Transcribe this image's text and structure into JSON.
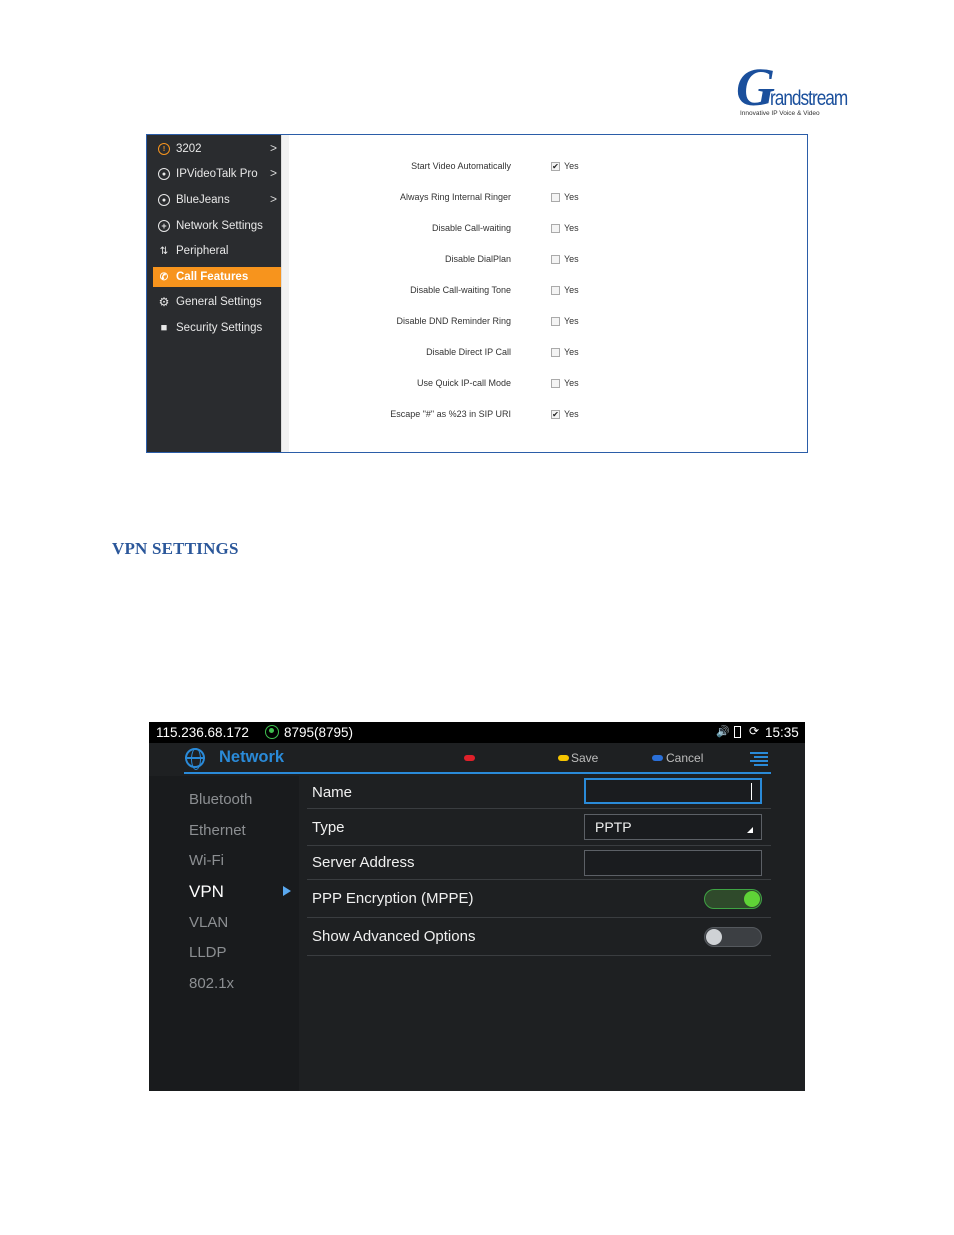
{
  "logo": {
    "brand": "Grandstream",
    "initial": "G",
    "word": "randstream",
    "tagline": "Innovative IP Voice & Video"
  },
  "call_features_screenshot": {
    "sidebar": [
      {
        "label": "3202",
        "icon": "account-icon",
        "active": false,
        "chevron": true
      },
      {
        "label": "IPVideoTalk Pro",
        "icon": "account-icon",
        "active": false,
        "chevron": true
      },
      {
        "label": "BlueJeans",
        "icon": "account-icon",
        "active": false,
        "chevron": true
      },
      {
        "label": "Network Settings",
        "icon": "globe-icon",
        "active": false,
        "chevron": false
      },
      {
        "label": "Peripheral",
        "icon": "peripheral-icon",
        "active": false,
        "chevron": false
      },
      {
        "label": "Call Features",
        "icon": "phone-icon",
        "active": true,
        "chevron": false
      },
      {
        "label": "General Settings",
        "icon": "gear-icon",
        "active": false,
        "chevron": false
      },
      {
        "label": "Security Settings",
        "icon": "lock-icon",
        "active": false,
        "chevron": false
      }
    ],
    "chevron_glyph": ">",
    "option_value_label": "Yes",
    "options": [
      {
        "label": "Start Video Automatically",
        "checked": true
      },
      {
        "label": "Always Ring Internal Ringer",
        "checked": false
      },
      {
        "label": "Disable Call-waiting",
        "checked": false
      },
      {
        "label": "Disable DialPlan",
        "checked": false
      },
      {
        "label": "Disable Call-waiting Tone",
        "checked": false
      },
      {
        "label": "Disable DND Reminder Ring",
        "checked": false
      },
      {
        "label": "Disable Direct IP Call",
        "checked": false
      },
      {
        "label": "Use Quick IP-call Mode",
        "checked": false
      },
      {
        "label": "Escape \"#\" as %23 in SIP URI",
        "checked": true
      }
    ]
  },
  "section_heading": "VPN SETTINGS",
  "vpn_screenshot": {
    "status_bar": {
      "ip": "115.236.68.172",
      "account": "8795(8795)",
      "time": "15:35"
    },
    "header": {
      "title": "Network",
      "save": "Save",
      "cancel": "Cancel"
    },
    "nav": [
      {
        "label": "Bluetooth",
        "active": false
      },
      {
        "label": "Ethernet",
        "active": false
      },
      {
        "label": "Wi-Fi",
        "active": false
      },
      {
        "label": "VPN",
        "active": true
      },
      {
        "label": "VLAN",
        "active": false
      },
      {
        "label": "LLDP",
        "active": false
      },
      {
        "label": "802.1x",
        "active": false
      }
    ],
    "fields": {
      "name_label": "Name",
      "name_value": "",
      "type_label": "Type",
      "type_value": "PPTP",
      "server_label": "Server Address",
      "server_value": "",
      "mppe_label": "PPP Encryption (MPPE)",
      "mppe_on": true,
      "advanced_label": "Show Advanced Options",
      "advanced_on": false
    },
    "colors": {
      "accent": "#2a8ad8",
      "toggle_on": "#5fd337",
      "save_dot": "#f5c400",
      "cancel_dot": "#2a6fd8",
      "record_dot": "#e0202a"
    }
  }
}
